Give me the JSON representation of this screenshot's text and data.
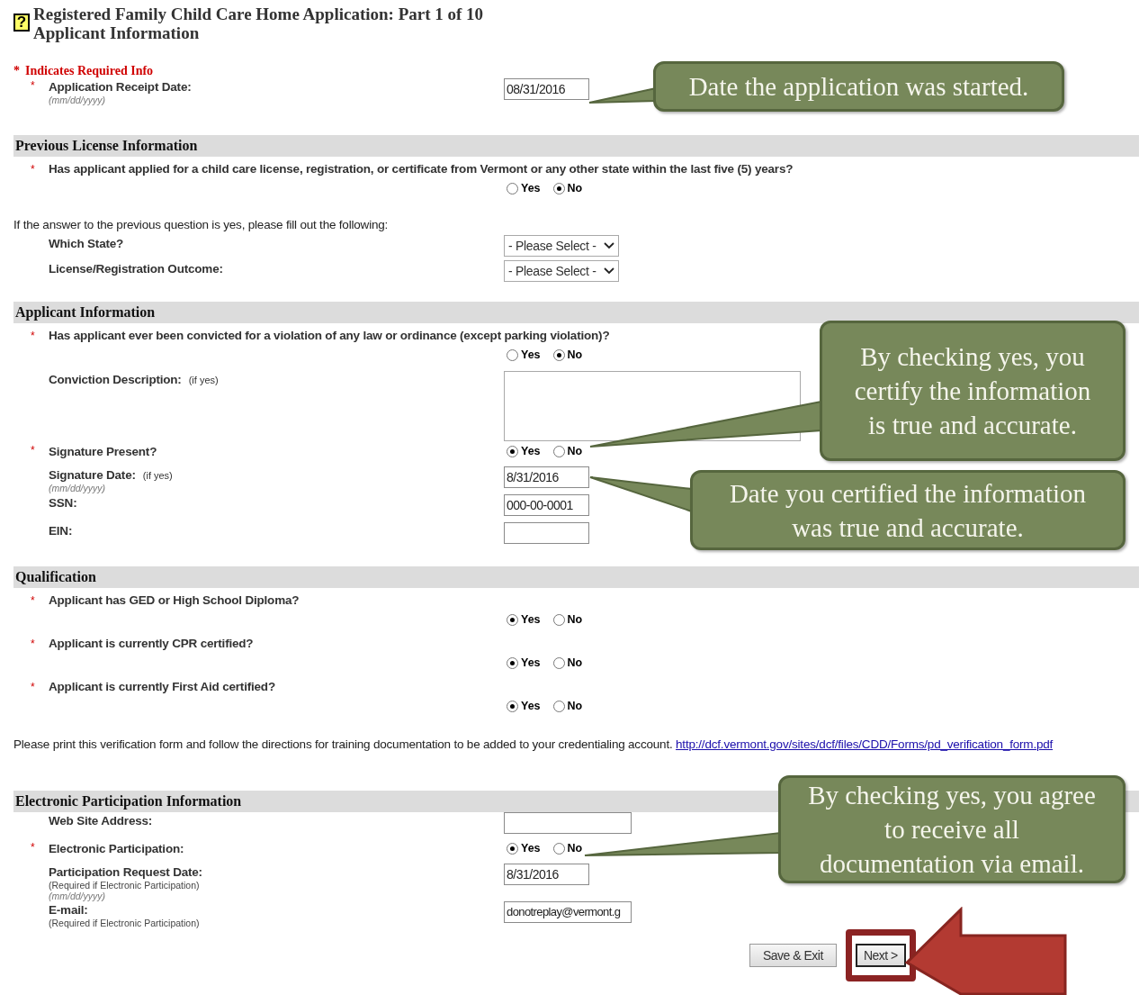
{
  "help_glyph": "?",
  "title_lines": [
    "Registered Family Child Care Home Application: Part 1 of 10",
    "Applicant Information"
  ],
  "required_mark": "*",
  "required_note": "Indicates Required Info",
  "sections": [
    {
      "rows": [
        {
          "kind": "text-field",
          "required": true,
          "label": "Application Receipt Date:",
          "hints": [
            {
              "kind": "format",
              "text": "(mm/dd/yyyy)"
            }
          ],
          "value": "08/31/2016",
          "wide": false
        }
      ]
    },
    {
      "heading": "Previous License Information",
      "rows": [
        {
          "kind": "question",
          "required": true,
          "label": "Has applicant applied for a child care license, registration, or certificate from Vermont or any other state within the last five (5) years?"
        },
        {
          "kind": "radio",
          "options": [
            {
              "label": "Yes",
              "selected": false
            },
            {
              "label": "No",
              "selected": true
            }
          ]
        },
        {
          "kind": "plain",
          "text": "If the answer to the previous question is yes, please fill out the following:"
        },
        {
          "kind": "select",
          "required": false,
          "label": "Which State?",
          "value": "- Please Select -"
        },
        {
          "kind": "select",
          "required": false,
          "label": "License/Registration Outcome:",
          "value": "- Please Select -"
        }
      ]
    },
    {
      "heading": "Applicant Information",
      "rows": [
        {
          "kind": "question",
          "required": true,
          "label": "Has applicant ever been convicted for a violation of any law or ordinance (except parking violation)?"
        },
        {
          "kind": "radio",
          "options": [
            {
              "label": "Yes",
              "selected": false
            },
            {
              "label": "No",
              "selected": true
            }
          ]
        },
        {
          "kind": "textarea",
          "required": false,
          "label": "Conviction Description:",
          "inline_hint": "(if yes)"
        },
        {
          "kind": "radio",
          "required": true,
          "label": "Signature Present?",
          "options": [
            {
              "label": "Yes",
              "selected": true
            },
            {
              "label": "No",
              "selected": false
            }
          ]
        },
        {
          "kind": "text-field",
          "required": false,
          "label": "Signature Date:",
          "inline_hint": "(if yes)",
          "hints": [
            {
              "kind": "format",
              "text": "(mm/dd/yyyy)"
            }
          ],
          "value": "8/31/2016",
          "wide": false
        },
        {
          "kind": "text-field",
          "required": false,
          "label": "SSN:",
          "value": "000-00-0001",
          "wide": false
        },
        {
          "kind": "text-field",
          "required": false,
          "label": "EIN:",
          "wide": false
        }
      ]
    },
    {
      "heading": "Qualification",
      "rows": [
        {
          "kind": "question",
          "required": true,
          "label": "Applicant has GED or High School Diploma?"
        },
        {
          "kind": "radio",
          "options": [
            {
              "label": "Yes",
              "selected": true
            },
            {
              "label": "No",
              "selected": false
            }
          ]
        },
        {
          "kind": "question",
          "required": true,
          "label": "Applicant is currently CPR certified?"
        },
        {
          "kind": "radio",
          "options": [
            {
              "label": "Yes",
              "selected": true
            },
            {
              "label": "No",
              "selected": false
            }
          ]
        },
        {
          "kind": "question",
          "required": true,
          "label": "Applicant is currently First Aid certified?"
        },
        {
          "kind": "radio",
          "options": [
            {
              "label": "Yes",
              "selected": true
            },
            {
              "label": "No",
              "selected": false
            }
          ]
        },
        {
          "kind": "link-note",
          "text": "Please print this verification form and follow the directions for training documentation to be added to your credentialing account.",
          "link": "http://dcf.vermont.gov/sites/dcf/files/CDD/Forms/pd_verification_form.pdf"
        }
      ]
    },
    {
      "heading": "Electronic Participation Information",
      "rows": [
        {
          "kind": "text-field",
          "required": false,
          "label": "Web Site Address:",
          "wide": true
        },
        {
          "kind": "radio",
          "required": true,
          "label": "Electronic Participation:",
          "options": [
            {
              "label": "Yes",
              "selected": true
            },
            {
              "label": "No",
              "selected": false
            }
          ]
        },
        {
          "kind": "text-field",
          "required": false,
          "label": "Participation Request Date:",
          "hints": [
            {
              "kind": "note",
              "text": "(Required if Electronic Participation)"
            },
            {
              "kind": "format",
              "text": "(mm/dd/yyyy)"
            }
          ],
          "value": "8/31/2016",
          "wide": false
        },
        {
          "kind": "text-field",
          "required": false,
          "label": "E-mail:",
          "hints": [
            {
              "kind": "note",
              "text": "(Required if Electronic Participation)"
            }
          ],
          "value": "donotreplay@vermont.g",
          "wide": true
        }
      ]
    }
  ],
  "buttons": [
    {
      "label": "Save & Exit",
      "highlighted": false
    },
    {
      "label": "Next >",
      "highlighted": true
    }
  ],
  "callouts": [
    {
      "lines": [
        "Date the application was started."
      ]
    },
    {
      "lines": [
        "By checking yes, you",
        "certify the information",
        "is true and accurate."
      ]
    },
    {
      "lines": [
        "Date you certified the information",
        "was true and accurate."
      ]
    },
    {
      "lines": [
        "By checking yes, you agree",
        "to receive all",
        "documentation via email."
      ]
    }
  ]
}
